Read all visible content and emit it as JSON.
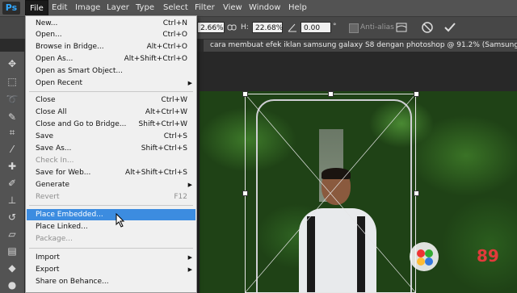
{
  "app": {
    "logo": "Ps"
  },
  "menubar": {
    "items": [
      "File",
      "Edit",
      "Image",
      "Layer",
      "Type",
      "Select",
      "Filter",
      "View",
      "Window",
      "Help"
    ]
  },
  "options": {
    "w_value": "2.66%",
    "h_label": "H:",
    "h_value": "22.68%",
    "angle_value": "0.00",
    "angle_unit": "°",
    "antialias_label": "Anti-alias"
  },
  "document_tab": {
    "title": "cara membuat efek iklan samsung galaxy S8 dengan photoshop @ 91.2% (Samsung-Galaxy-S"
  },
  "file_menu": {
    "items": [
      {
        "label": "New...",
        "shortcut": "Ctrl+N"
      },
      {
        "label": "Open...",
        "shortcut": "Ctrl+O"
      },
      {
        "label": "Browse in Bridge...",
        "shortcut": "Alt+Ctrl+O"
      },
      {
        "label": "Open As...",
        "shortcut": "Alt+Shift+Ctrl+O"
      },
      {
        "label": "Open as Smart Object...",
        "shortcut": ""
      },
      {
        "label": "Open Recent",
        "shortcut": ""
      },
      {
        "label": "Close",
        "shortcut": "Ctrl+W"
      },
      {
        "label": "Close All",
        "shortcut": "Alt+Ctrl+W"
      },
      {
        "label": "Close and Go to Bridge...",
        "shortcut": "Shift+Ctrl+W"
      },
      {
        "label": "Save",
        "shortcut": "Ctrl+S"
      },
      {
        "label": "Save As...",
        "shortcut": "Shift+Ctrl+S"
      },
      {
        "label": "Check In...",
        "shortcut": ""
      },
      {
        "label": "Save for Web...",
        "shortcut": "Alt+Shift+Ctrl+S"
      },
      {
        "label": "Generate",
        "shortcut": ""
      },
      {
        "label": "Revert",
        "shortcut": "F12"
      },
      {
        "label": "Place Embedded...",
        "shortcut": ""
      },
      {
        "label": "Place Linked...",
        "shortcut": ""
      },
      {
        "label": "Package...",
        "shortcut": ""
      },
      {
        "label": "Import",
        "shortcut": ""
      },
      {
        "label": "Export",
        "shortcut": ""
      },
      {
        "label": "Share on Behance...",
        "shortcut": ""
      }
    ]
  },
  "watermark": {
    "text": "89"
  },
  "colors": {
    "highlight": "#3c8ce0",
    "menu_bg": "#f0f0f0",
    "chrome": "#535353"
  }
}
